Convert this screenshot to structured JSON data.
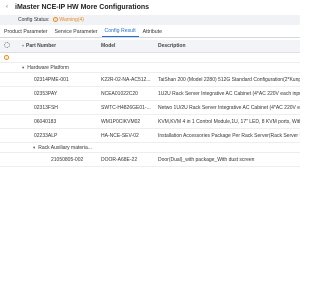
{
  "header": {
    "title": "iMaster NCE-IP HW More Configurations"
  },
  "status": {
    "label": "Config Status:",
    "value": "Warning(4)",
    "warn_color": "#e88a1a"
  },
  "tabs": [
    {
      "label": "Product Parameter"
    },
    {
      "label": "Service Parameter"
    },
    {
      "label": "Config Result"
    },
    {
      "label": "Attribute"
    }
  ],
  "active_tab": "Config Result",
  "table": {
    "columns": {
      "part": "Part Number",
      "model": "Model",
      "desc": "Description"
    },
    "groups": {
      "hardware": "Hardware Platform",
      "rack": "Rack Auxiliary materia..."
    },
    "rows": [
      {
        "part": "02314PME-001",
        "model": "K22R-02-NA-AC512...",
        "desc": "TaiShan 200 (Model 2280) 512G Standard Configuration(2*Kunpeng 920 5250 48Core 2.6GHz,1..."
      },
      {
        "part": "02353PAY",
        "model": "NCEA01022C20",
        "desc": "1U2U Rack Server Integrative AC Cabinet (4*AC 220V each input)"
      },
      {
        "part": "02313FSH",
        "model": "SWTC-H4826GE01-...",
        "desc": "Netwo 1U/2U Rack Server Integrative AC Cabinet (4*AC 220V each input)"
      },
      {
        "part": "06040183",
        "model": "WM1P0CIKVM02",
        "desc": "KVM,KVM 4 in 1 Control Module,1U, 17\" LED, 8 KVM ports, Without C..."
      },
      {
        "part": "02233ALP",
        "model": "HA-NCE-SEV-02",
        "desc": "Installation Accessories Package Per Rack Server(Rack Server Install..."
      },
      {
        "part": "21050805-002",
        "model": "DOOR-A68E-22",
        "desc": "Door(Dual)_with package_With dust screen"
      }
    ]
  }
}
